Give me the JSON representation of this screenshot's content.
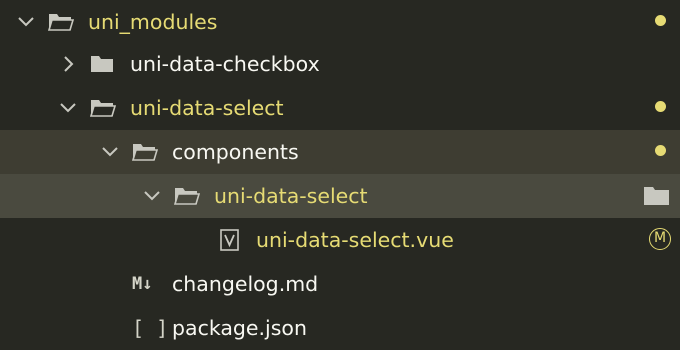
{
  "explorer": {
    "rows": [
      {
        "label": "uni_modules",
        "expanded": true,
        "git_status": "modified-dot"
      },
      {
        "label": "uni-data-checkbox",
        "expanded": false,
        "git_status": ""
      },
      {
        "label": "uni-data-select",
        "expanded": true,
        "git_status": "modified-dot"
      },
      {
        "label": "components",
        "expanded": true,
        "git_status": "modified-dot"
      },
      {
        "label": "uni-data-select",
        "expanded": true,
        "git_status": "folder-icon"
      },
      {
        "label": "uni-data-select.vue",
        "icon": "vue-file-icon",
        "git_status": "M"
      },
      {
        "label": "changelog.md",
        "icon": "markdown-icon",
        "icon_text": "M↓",
        "git_status": ""
      },
      {
        "label": "package.json",
        "icon": "json-icon",
        "icon_text": "[ ]",
        "git_status": ""
      }
    ]
  },
  "colors": {
    "background": "#272822",
    "modified_text": "#e6db74",
    "plain_text": "#f8f8f2",
    "active_row": "#3e3d32",
    "selected_row": "#4a4a3f"
  }
}
